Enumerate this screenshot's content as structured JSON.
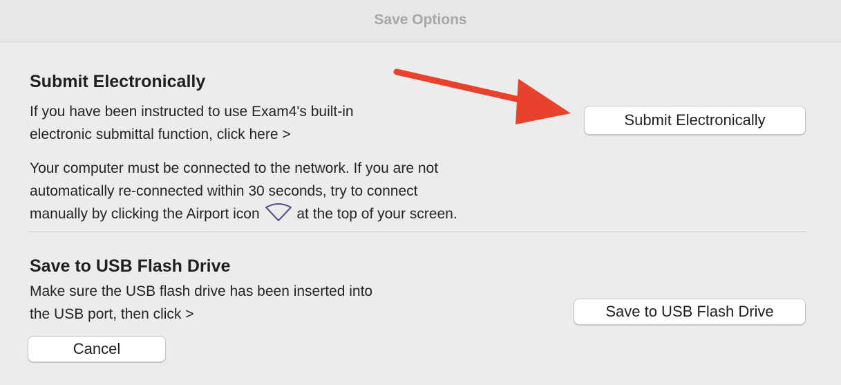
{
  "window": {
    "title": "Save Options"
  },
  "submit_section": {
    "heading": "Submit Electronically",
    "description_lines": [
      "If you have been instructed to use Exam4's built-in",
      "electronic submittal function, click here >"
    ],
    "network_note_lines": [
      "Your computer must be connected to the network. If you are not",
      "automatically re-connected within 30 seconds, try to connect",
      "manually by clicking the Airport icon",
      "at the top of your screen."
    ],
    "button_label": "Submit Electronically"
  },
  "usb_section": {
    "heading": "Save to USB Flash Drive",
    "description_lines": [
      "Make sure the USB flash drive has been inserted into",
      "the USB port, then click >"
    ],
    "button_label": "Save to USB Flash Drive"
  },
  "cancel_button_label": "Cancel",
  "icons": {
    "airport": "wifi-icon",
    "annotation_arrow": "arrow-icon"
  },
  "colors": {
    "arrow": "#e8412c",
    "background": "#ececec",
    "title_text": "#a7a7a7"
  }
}
